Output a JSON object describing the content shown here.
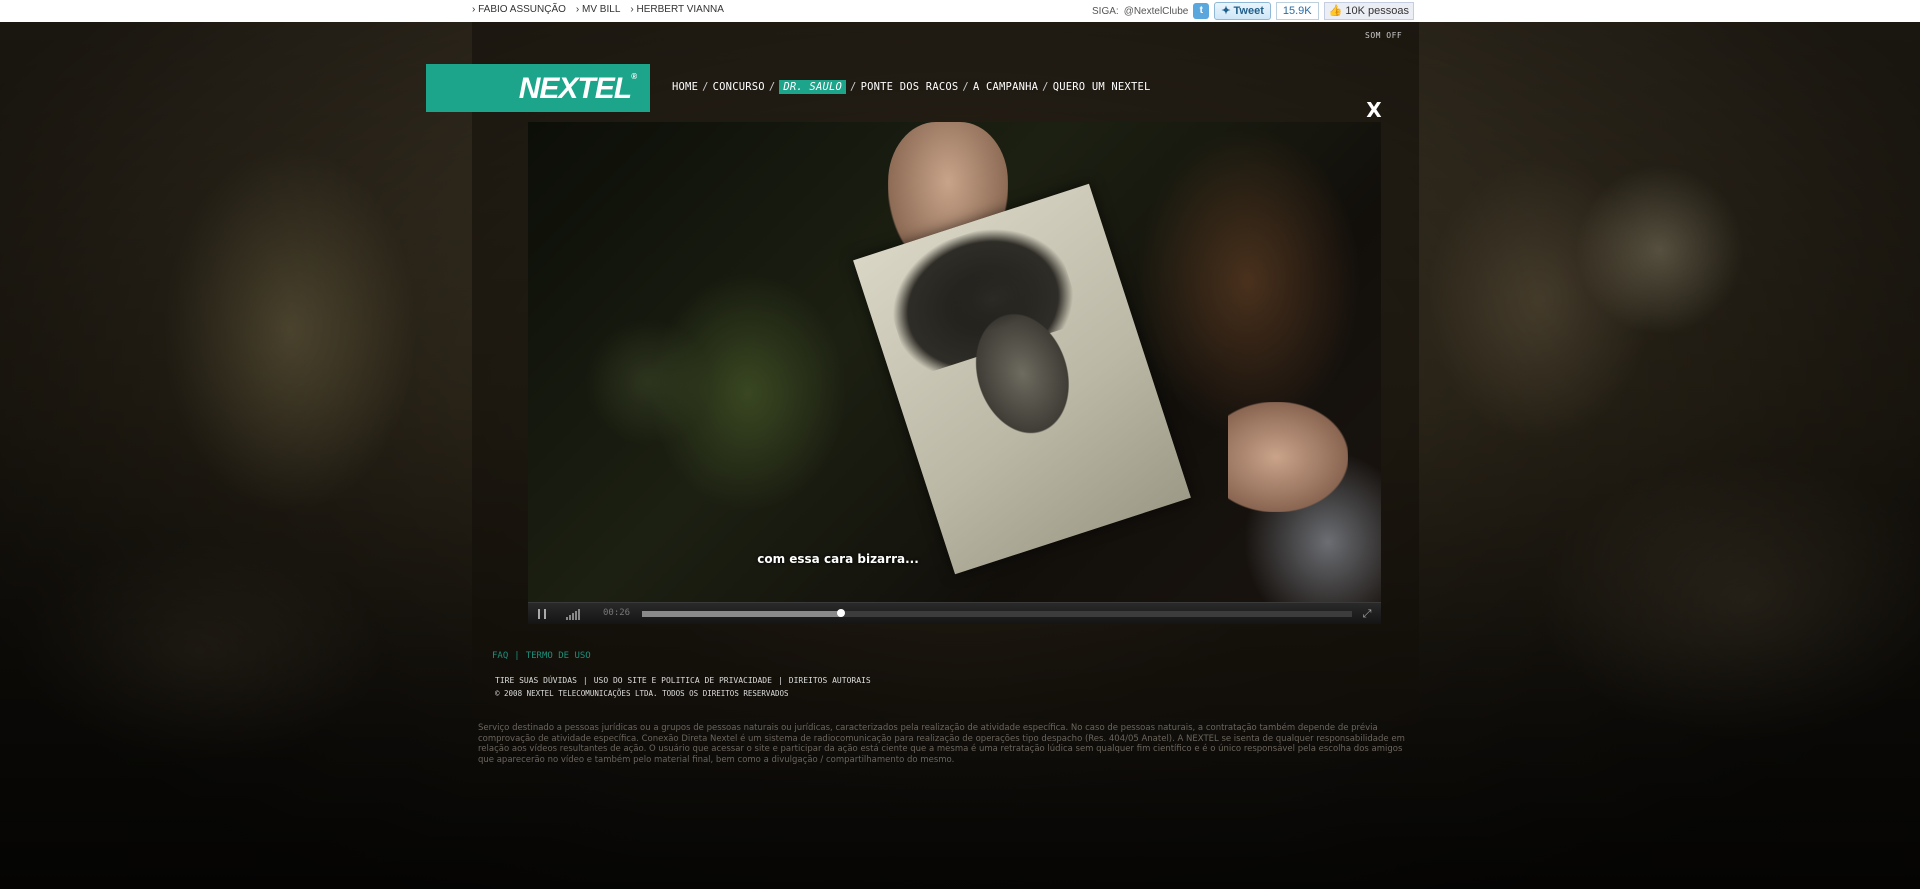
{
  "top_links": [
    "› FABIO ASSUNÇÃO",
    "› MV BILL",
    "› HERBERT VIANNA"
  ],
  "social": {
    "siga_label": "SIGA:",
    "twitter_handle": "@NextelClube",
    "tweet_label": "Tweet",
    "tweet_count": "15.9K",
    "like_label": "10K pessoas"
  },
  "sound_toggle": "SOM OFF",
  "logo": {
    "text": "NEXTEL",
    "brand_color": "#1da58b"
  },
  "nav": {
    "items": [
      "HOME",
      "CONCURSO",
      "DR. SAULO",
      "PONTE DOS RACOS",
      "A CAMPANHA",
      "QUERO UM NEXTEL"
    ],
    "active_index": 2,
    "separator": "/"
  },
  "close_label": "X",
  "video": {
    "subtitle": "com essa cara bizarra...",
    "time": "00:26",
    "progress": 0.28,
    "controls": {
      "pause_icon": "pause-icon",
      "volume_icon": "volume-bars-icon",
      "fullscreen_icon": "fullscreen-icon"
    }
  },
  "footer": {
    "faq": "FAQ",
    "divider": "|",
    "terms": "TERMO DE USO",
    "links": [
      "TIRE SUAS DÚVIDAS",
      "|",
      "USO DO SITE E POLITICA DE PRIVACIDADE",
      "|",
      "DIREITOS AUTORAIS"
    ],
    "copyright": "© 2008 NEXTEL TELECOMUNICAÇÕES LTDA. TODOS OS DIREITOS RESERVADOS",
    "disclaimer": "Serviço destinado a pessoas jurídicas ou a grupos de pessoas naturais ou jurídicas, caracterizados pela realização de atividade específica. No caso de pessoas naturais, a contratação também depende de prévia comprovação de atividade específica. Conexão Direta Nextel é um sistema de radiocomunicação para realização de operações tipo despacho (Res. 404/05 Anatel). A NEXTEL se isenta de qualquer responsabilidade em relação aos vídeos resultantes de ação. O usuário que acessar o site e participar da ação está ciente que a mesma é uma retratação lúdica sem qualquer fim científico e é o único responsável pela escolha dos amigos que aparecerão no vídeo e também pelo material final, bem como a divulgação / compartilhamento do mesmo."
  }
}
